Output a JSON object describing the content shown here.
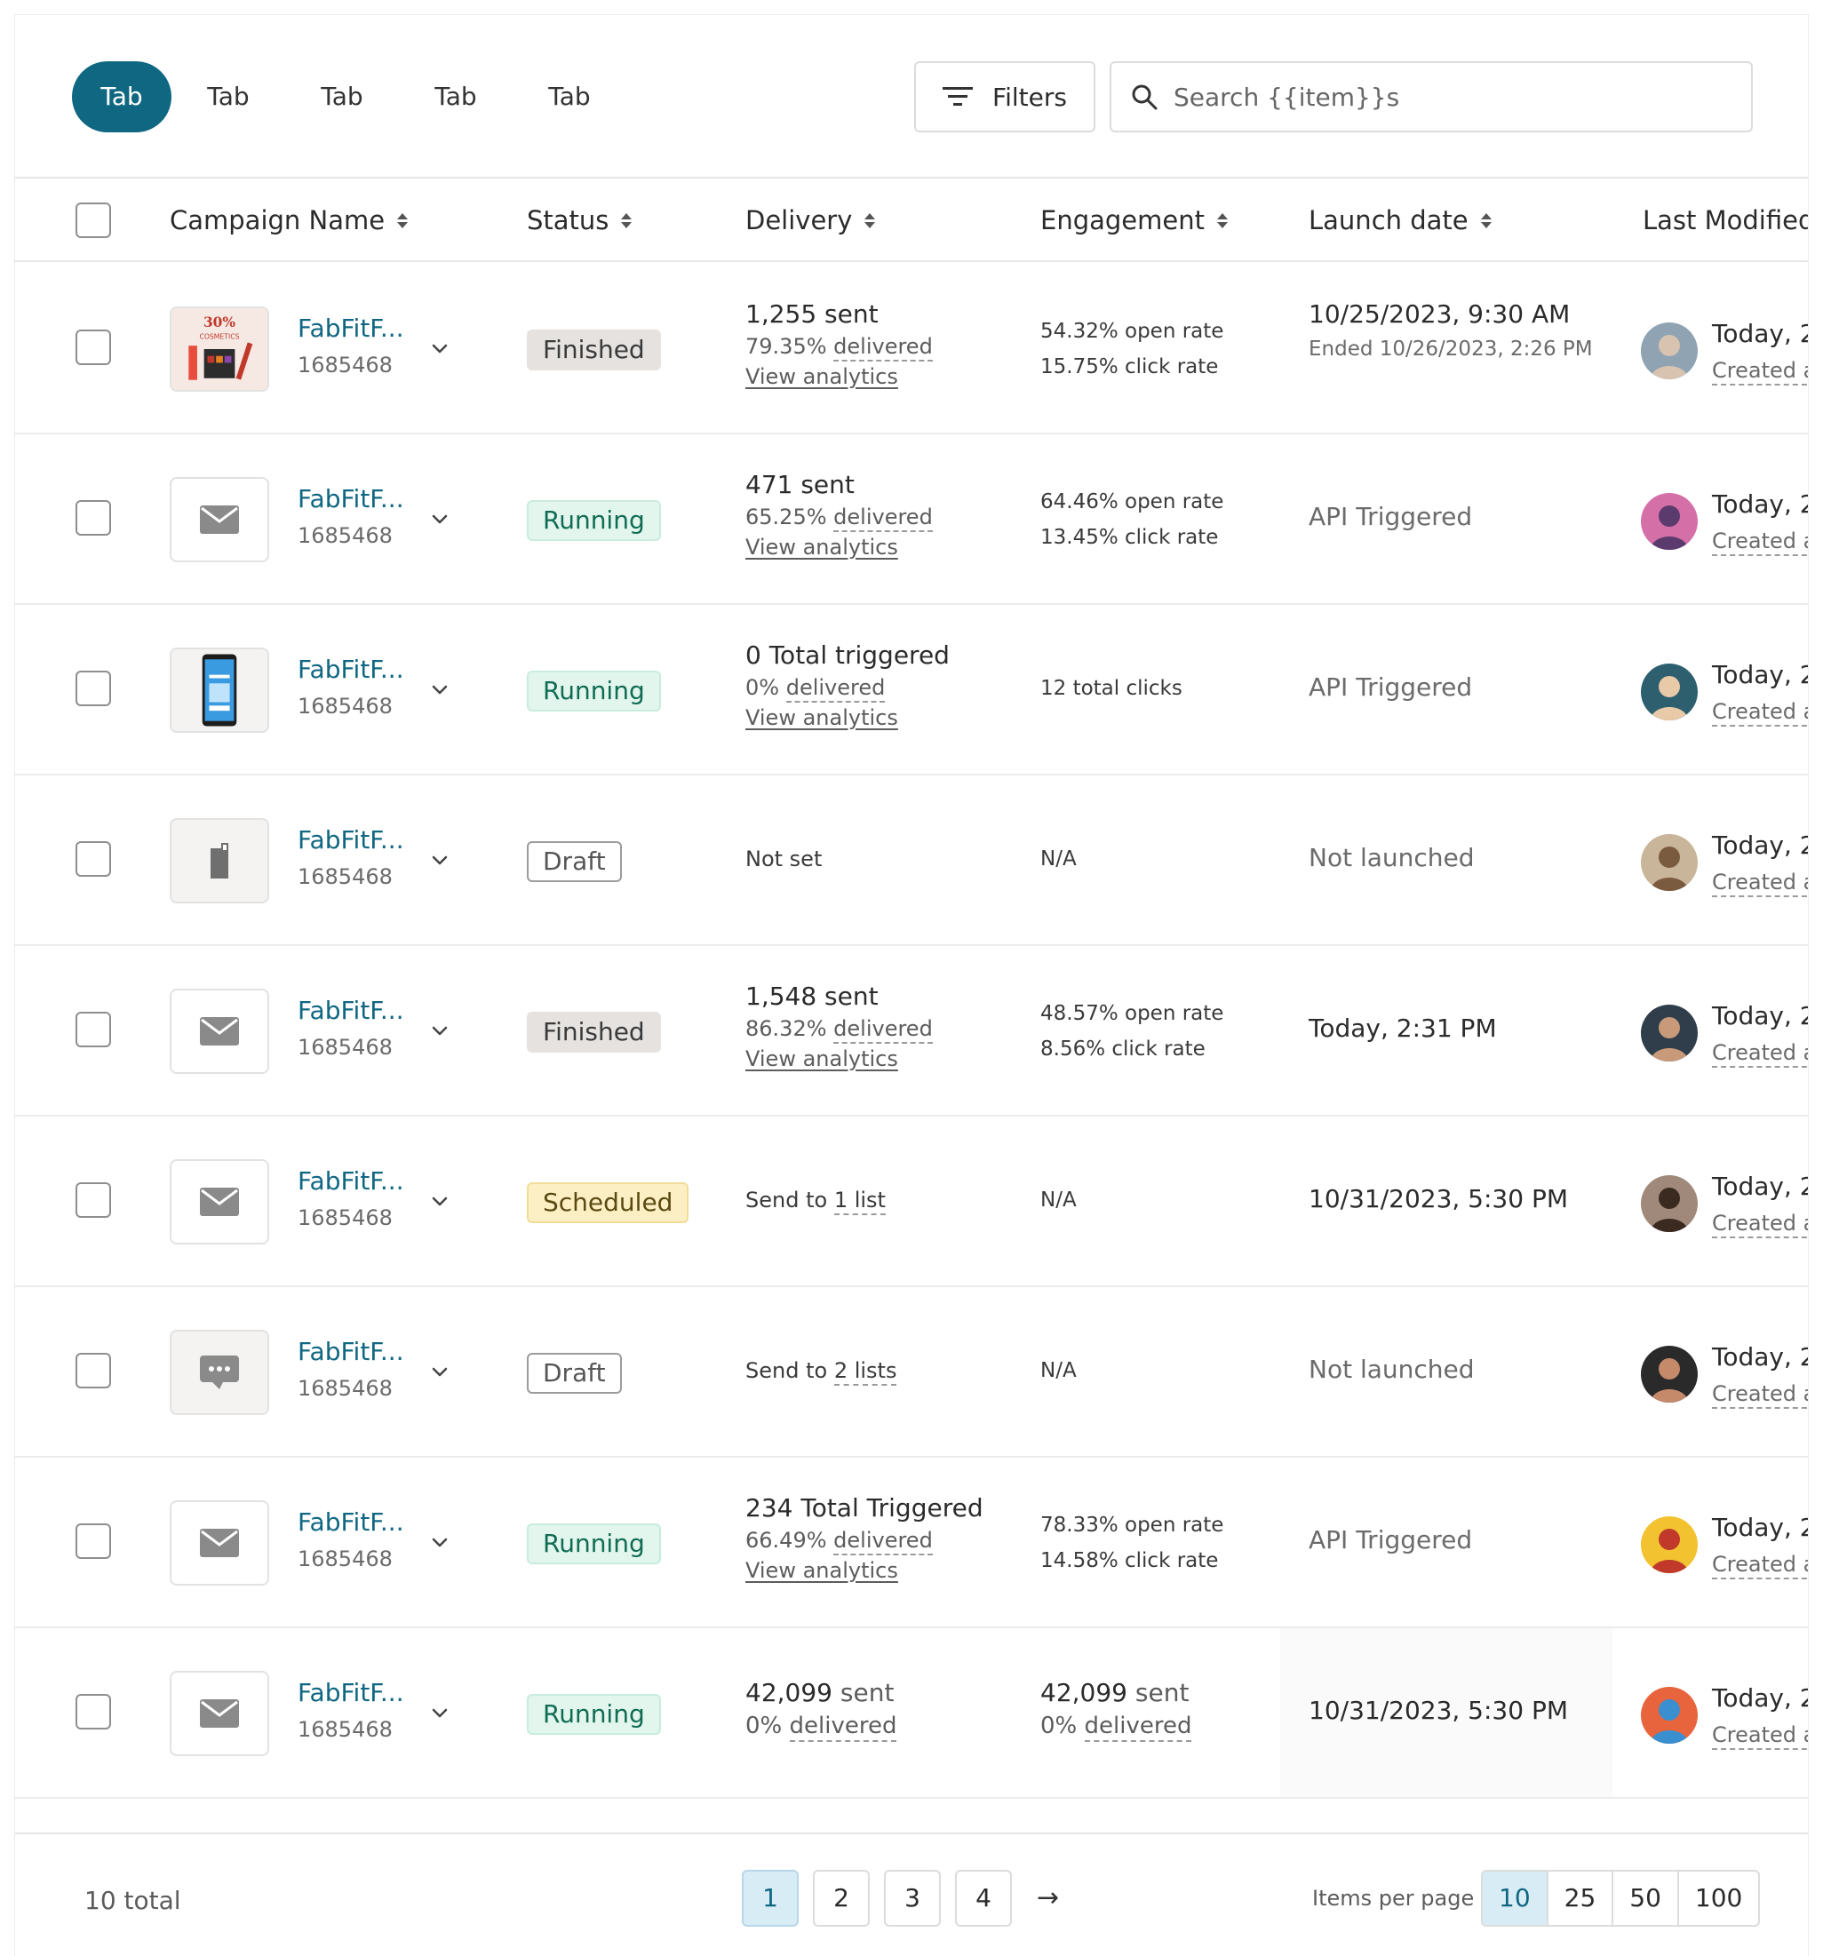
{
  "tabs": [
    "Tab",
    "Tab",
    "Tab",
    "Tab",
    "Tab"
  ],
  "toolbar": {
    "filters_label": "Filters",
    "search_placeholder": "Search {{item}}s"
  },
  "columns": {
    "campaign": "Campaign Name",
    "status": "Status",
    "delivery": "Delivery",
    "engagement": "Engagement",
    "launch": "Launch date",
    "modified": "Last Modified"
  },
  "rows": [
    {
      "thumb": "cosmetics-image",
      "name": "FabFitF...",
      "id": "1685468",
      "status": "Finished",
      "status_type": "finished",
      "delivery": {
        "main": "1,255 sent",
        "pct": "79.35%",
        "pct_label": "delivered",
        "link": "View analytics"
      },
      "engagement": {
        "line1": "54.32% open rate",
        "line2": "15.75% click rate"
      },
      "launch": {
        "main": "10/25/2023, 9:30 AM",
        "sub": "Ended 10/26/2023, 2:26 PM"
      },
      "modified": {
        "line1": "Today, 2",
        "line2": "Created a"
      }
    },
    {
      "thumb": "mail-icon",
      "name": "FabFitF...",
      "id": "1685468",
      "status": "Running",
      "status_type": "running",
      "delivery": {
        "main": "471 sent",
        "pct": "65.25%",
        "pct_label": "delivered",
        "link": "View analytics"
      },
      "engagement": {
        "line1": "64.46% open rate",
        "line2": "13.45% click rate"
      },
      "launch": {
        "main": "API Triggered"
      },
      "modified": {
        "line1": "Today, 2",
        "line2": "Created a"
      }
    },
    {
      "thumb": "phone-image",
      "name": "FabFitF...",
      "id": "1685468",
      "status": "Running",
      "status_type": "running",
      "delivery": {
        "main": "0 Total triggered",
        "pct": "0%",
        "pct_label": "delivered",
        "link": "View analytics"
      },
      "engagement": {
        "line1": "12 total clicks"
      },
      "launch": {
        "main": "API Triggered"
      },
      "modified": {
        "line1": "Today, 2",
        "line2": "Created a"
      }
    },
    {
      "thumb": "mobile-icon",
      "name": "FabFitF...",
      "id": "1685468",
      "status": "Draft",
      "status_type": "draft",
      "delivery": {
        "main": "Not set"
      },
      "engagement": {
        "line1": "N/A"
      },
      "launch": {
        "main": "Not launched"
      },
      "modified": {
        "line1": "Today, 2",
        "line2": "Created a"
      }
    },
    {
      "thumb": "mail-icon",
      "name": "FabFitF...",
      "id": "1685468",
      "status": "Finished",
      "status_type": "finished",
      "delivery": {
        "main": "1,548 sent",
        "pct": "86.32%",
        "pct_label": "delivered",
        "link": "View analytics"
      },
      "engagement": {
        "line1": "48.57% open rate",
        "line2": "8.56% click rate"
      },
      "launch": {
        "main": "Today, 2:31 PM"
      },
      "modified": {
        "line1": "Today, 2",
        "line2": "Created a"
      }
    },
    {
      "thumb": "mail-icon",
      "name": "FabFitF...",
      "id": "1685468",
      "status": "Scheduled",
      "status_type": "scheduled",
      "delivery": {
        "send_prefix": "Send to",
        "send_link": "1 list"
      },
      "engagement": {
        "line1": "N/A"
      },
      "launch": {
        "main": "10/31/2023, 5:30 PM"
      },
      "modified": {
        "line1": "Today, 2",
        "line2": "Created a"
      }
    },
    {
      "thumb": "chat-icon",
      "name": "FabFitF...",
      "id": "1685468",
      "status": "Draft",
      "status_type": "draft",
      "delivery": {
        "send_prefix": "Send to",
        "send_link": "2 lists"
      },
      "engagement": {
        "line1": "N/A"
      },
      "launch": {
        "main": "Not launched"
      },
      "modified": {
        "line1": "Today, 2",
        "line2": "Created a"
      }
    },
    {
      "thumb": "mail-icon",
      "name": "FabFitF...",
      "id": "1685468",
      "status": "Running",
      "status_type": "running",
      "delivery": {
        "main": "234 Total Triggered",
        "pct": "66.49%",
        "pct_label": "delivered",
        "link": "View analytics"
      },
      "engagement": {
        "line1": "78.33% open rate",
        "line2": "14.58% click rate"
      },
      "launch": {
        "main": "API Triggered"
      },
      "modified": {
        "line1": "Today, 2",
        "line2": "Created a"
      }
    },
    {
      "thumb": "mail-icon",
      "name": "FabFitF...",
      "id": "1685468",
      "status": "Running",
      "status_type": "running",
      "delivery": {
        "main_num": "42,099",
        "main_unit": "sent",
        "pct": "0%",
        "pct_label": "delivered"
      },
      "engagement": {
        "num": "42,099",
        "unit": "sent",
        "pct": "0%",
        "pct_label": "delivered"
      },
      "launch": {
        "main": "10/31/2023, 5:30 PM"
      },
      "modified": {
        "line1": "Today, 2",
        "line2": "Created a"
      }
    }
  ],
  "footer": {
    "total": "10 total",
    "pages": [
      "1",
      "2",
      "3",
      "4"
    ],
    "next_icon": "arrow-right-icon",
    "items_label": "Items per page",
    "per_page": [
      "10",
      "25",
      "50",
      "100"
    ]
  },
  "colors": {
    "primary": "#0f6782",
    "accent_bg": "#d8ecf6"
  }
}
